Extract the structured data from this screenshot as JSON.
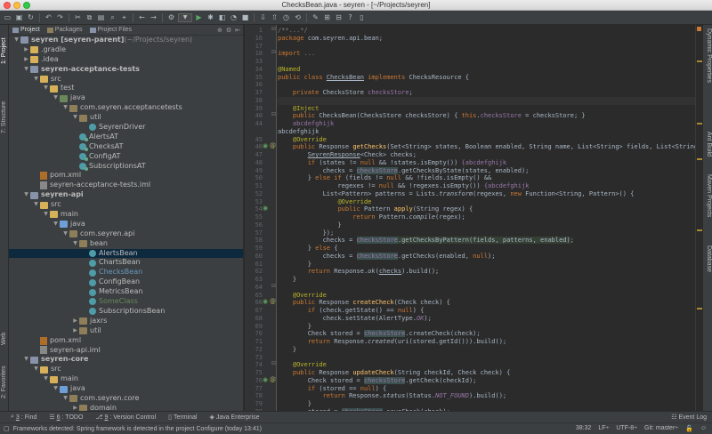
{
  "window": {
    "title": "ChecksBean.java - seyren - [~/Projects/seyren]"
  },
  "toolbar": {
    "buttons": [
      "open-icon",
      "save-icon",
      "sync-icon",
      "undo-icon",
      "redo-icon",
      "cut-icon",
      "copy-icon",
      "paste-icon",
      "find-icon",
      "replace-icon",
      "back-icon",
      "forward-icon",
      "make-icon",
      "run-config-dropdown",
      "run-icon",
      "debug-icon",
      "coverage-icon",
      "profile-icon",
      "stop-icon",
      "vcs-update-icon",
      "vcs-commit-icon",
      "history-icon",
      "revert-icon",
      "settings-icon",
      "structure-icon",
      "sdk-icon",
      "help-icon",
      "terminal-icon"
    ]
  },
  "left_strip": {
    "tabs": [
      "1: Project",
      "7: Structure",
      "Web",
      "2: Favorites"
    ]
  },
  "right_strip": {
    "tabs": [
      "Dynamic Properties",
      "Ant Build",
      "Maven Projects",
      "Database"
    ]
  },
  "project": {
    "tabs": [
      "Project",
      "Packages",
      "Project Files"
    ],
    "tree": [
      {
        "depth": 0,
        "arrow": "▼",
        "icon": "module",
        "label": "seyren [seyren-parent]",
        "suffix": " (~/Projects/seyren)",
        "bold": true
      },
      {
        "depth": 1,
        "arrow": "▶",
        "icon": "folder",
        "label": ".gradle"
      },
      {
        "depth": 1,
        "arrow": "▶",
        "icon": "folder",
        "label": ".idea"
      },
      {
        "depth": 1,
        "arrow": "▼",
        "icon": "module",
        "label": "seyren-acceptance-tests",
        "bold": true
      },
      {
        "depth": 2,
        "arrow": "▼",
        "icon": "folder",
        "label": "src"
      },
      {
        "depth": 3,
        "arrow": "▼",
        "icon": "folder",
        "label": "test"
      },
      {
        "depth": 4,
        "arrow": "▼",
        "icon": "folder green",
        "label": "java"
      },
      {
        "depth": 5,
        "arrow": "▼",
        "icon": "pkg",
        "label": "com.seyren.acceptancetests"
      },
      {
        "depth": 6,
        "arrow": "▼",
        "icon": "pkg",
        "label": "util"
      },
      {
        "depth": 7,
        "arrow": "",
        "icon": "cls",
        "label": "SeyrenDriver"
      },
      {
        "depth": 6,
        "arrow": "",
        "icon": "cls green",
        "label": "AlertsAT"
      },
      {
        "depth": 6,
        "arrow": "",
        "icon": "cls green",
        "label": "ChecksAT"
      },
      {
        "depth": 6,
        "arrow": "",
        "icon": "cls green",
        "label": "ConfigAT"
      },
      {
        "depth": 6,
        "arrow": "",
        "icon": "cls green",
        "label": "SubscriptionsAT"
      },
      {
        "depth": 2,
        "arrow": "",
        "icon": "xml",
        "label": "pom.xml"
      },
      {
        "depth": 2,
        "arrow": "",
        "icon": "iml",
        "label": "seyren-acceptance-tests.iml"
      },
      {
        "depth": 1,
        "arrow": "▼",
        "icon": "module",
        "label": "seyren-api",
        "bold": true
      },
      {
        "depth": 2,
        "arrow": "▼",
        "icon": "folder",
        "label": "src"
      },
      {
        "depth": 3,
        "arrow": "▼",
        "icon": "folder",
        "label": "main"
      },
      {
        "depth": 4,
        "arrow": "▼",
        "icon": "folder blue",
        "label": "java"
      },
      {
        "depth": 5,
        "arrow": "▼",
        "icon": "pkg",
        "label": "com.seyren.api"
      },
      {
        "depth": 6,
        "arrow": "▼",
        "icon": "pkg",
        "label": "bean"
      },
      {
        "depth": 7,
        "arrow": "",
        "icon": "cls",
        "label": "AlertsBean",
        "selected": true
      },
      {
        "depth": 7,
        "arrow": "",
        "icon": "cls",
        "label": "ChartsBean"
      },
      {
        "depth": 7,
        "arrow": "",
        "icon": "cls",
        "label": "ChecksBean",
        "color": "blue"
      },
      {
        "depth": 7,
        "arrow": "",
        "icon": "cls",
        "label": "ConfigBean"
      },
      {
        "depth": 7,
        "arrow": "",
        "icon": "cls",
        "label": "MetricsBean"
      },
      {
        "depth": 7,
        "arrow": "",
        "icon": "cls",
        "label": "SomeClass",
        "color": "green"
      },
      {
        "depth": 7,
        "arrow": "",
        "icon": "cls",
        "label": "SubscriptionsBean"
      },
      {
        "depth": 6,
        "arrow": "▶",
        "icon": "pkg",
        "label": "jaxrs"
      },
      {
        "depth": 6,
        "arrow": "▶",
        "icon": "pkg",
        "label": "util"
      },
      {
        "depth": 2,
        "arrow": "",
        "icon": "xml",
        "label": "pom.xml"
      },
      {
        "depth": 2,
        "arrow": "",
        "icon": "iml",
        "label": "seyren-api.iml"
      },
      {
        "depth": 1,
        "arrow": "▼",
        "icon": "module",
        "label": "seyren-core",
        "bold": true
      },
      {
        "depth": 2,
        "arrow": "▼",
        "icon": "folder",
        "label": "src"
      },
      {
        "depth": 3,
        "arrow": "▼",
        "icon": "folder",
        "label": "main"
      },
      {
        "depth": 4,
        "arrow": "▼",
        "icon": "folder blue",
        "label": "java"
      },
      {
        "depth": 5,
        "arrow": "▼",
        "icon": "pkg",
        "label": "com.seyren.core"
      },
      {
        "depth": 6,
        "arrow": "▶",
        "icon": "pkg",
        "label": "domain"
      },
      {
        "depth": 6,
        "arrow": "▶",
        "icon": "pkg",
        "label": "exception"
      }
    ]
  },
  "editor": {
    "current_line": 38,
    "lines": [
      {
        "n": "1",
        "html": "<span class=\"cm\">/**...*/</span>"
      },
      {
        "n": "16",
        "html": "<span class=\"kw\">package</span> com.seyren.api.bean;"
      },
      {
        "n": "17",
        "html": ""
      },
      {
        "n": "18",
        "html": "<span class=\"kw\">import</span> <span class=\"cm\">...</span>"
      },
      {
        "n": "33",
        "html": ""
      },
      {
        "n": "34",
        "html": "<span class=\"an\">@Named</span>"
      },
      {
        "n": "35",
        "html": "<span class=\"kw\">public class</span> <span class=\"ul\">ChecksBean</span> <span class=\"kw\">implements</span> ChecksResource {"
      },
      {
        "n": "36",
        "html": ""
      },
      {
        "n": "37",
        "html": "    <span class=\"kw\">private</span> ChecksStore <span class=\"fd\">checksStore</span>;"
      },
      {
        "n": "38",
        "html": ""
      },
      {
        "n": "39",
        "html": "    <span class=\"an\">@Inject</span>"
      },
      {
        "n": "40",
        "html": "    <span class=\"kw\">public</span> ChecksBean(ChecksStore checksStore) { <span class=\"kw\">this</span>.<span class=\"fd\">checksStore</span> = checksStore; }"
      },
      {
        "n": "44",
        "html": "    <span class=\"fd\">abcdefghijk</span>"
      },
      {
        "n": "",
        "html": "abcdefghijk"
      },
      {
        "n": "45",
        "html": "    <span class=\"an\">@Override</span>"
      },
      {
        "n": "46",
        "html": "    <span class=\"kw\">public</span> Response <span class=\"fn\">getChecks</span>(Set&lt;String&gt; states, Boolean enabled, String name, List&lt;String&gt; fields, List&lt;String&gt; regexes) {"
      },
      {
        "n": "47",
        "html": "        <span class=\"ul\">SeyrenResponse</span>&lt;Check&gt; checks;"
      },
      {
        "n": "48",
        "html": "        <span class=\"kw\">if</span> (states != <span class=\"kw\">null</span> &amp;&amp; !states.isEmpty()) <span class=\"fd\">{abcdefghijk</span>"
      },
      {
        "n": "49",
        "html": "            checks = <span class=\"fd hl2\">checksStore</span>.getChecksByState(states, enabled);"
      },
      {
        "n": "50",
        "html": "        } <span class=\"kw\">else if</span> (fields != <span class=\"kw\">null</span> &amp;&amp; !fields.isEmpty() &amp;&amp;"
      },
      {
        "n": "51",
        "html": "                regexes != <span class=\"kw\">null</span> &amp;&amp; !regexes.isEmpty()) <span class=\"fd\">{abcdefghijk</span>"
      },
      {
        "n": "52",
        "html": "            List&lt;Pattern&gt; patterns = Lists.<span class=\"it\">transform</span>(regexes, <span class=\"kw\">new</span> Function&lt;String, Pattern&gt;() {"
      },
      {
        "n": "53",
        "html": "                <span class=\"an\">@Override</span>"
      },
      {
        "n": "54",
        "html": "                <span class=\"kw\">public</span> Pattern <span class=\"fn\">apply</span>(String regex) {"
      },
      {
        "n": "55",
        "html": "                    <span class=\"kw\">return</span> Pattern.<span class=\"it\">compile</span>(regex);"
      },
      {
        "n": "56",
        "html": "                }"
      },
      {
        "n": "57",
        "html": "            });"
      },
      {
        "n": "58",
        "html": "            checks = <span class=\"fd hl2\">checksStore</span><span class=\"hl\">.getChecksByPattern(fields, patterns, enabled)</span>;"
      },
      {
        "n": "59",
        "html": "        } <span class=\"kw\">else</span> {"
      },
      {
        "n": "60",
        "html": "            checks = <span class=\"fd hl2\">checksStore</span>.getChecks(enabled, <span class=\"kw\">null</span>);"
      },
      {
        "n": "61",
        "html": "        }"
      },
      {
        "n": "62",
        "html": "        <span class=\"kw\">return</span> Response.<span class=\"it\">ok</span>(<span class=\"ul\">checks</span>).build();"
      },
      {
        "n": "63",
        "html": "    }"
      },
      {
        "n": "64",
        "html": ""
      },
      {
        "n": "65",
        "html": "    <span class=\"an\">@Override</span>"
      },
      {
        "n": "66",
        "html": "    <span class=\"kw\">public</span> Response <span class=\"fn\">createCheck</span>(Check check) {"
      },
      {
        "n": "67",
        "html": "        <span class=\"kw\">if</span> (check.getState() == <span class=\"kw\">null</span>) {"
      },
      {
        "n": "68",
        "html": "            check.setState(AlertType.<span class=\"fd it\">OK</span>);"
      },
      {
        "n": "69",
        "html": "        }"
      },
      {
        "n": "70",
        "html": "        Check stored = <span class=\"fd hl2\">checksStore</span>.createCheck(check);"
      },
      {
        "n": "71",
        "html": "        <span class=\"kw\">return</span> Response.<span class=\"it\">created</span>(uri(stored.getId())).build();"
      },
      {
        "n": "72",
        "html": "    }"
      },
      {
        "n": "73",
        "html": ""
      },
      {
        "n": "74",
        "html": "    <span class=\"an\">@Override</span>"
      },
      {
        "n": "75",
        "html": "    <span class=\"kw\">public</span> Response <span class=\"fn\">updateCheck</span>(String checkId, Check check) {"
      },
      {
        "n": "76",
        "html": "        Check stored = <span class=\"fd hl2\">checksStore</span>.getCheck(checkId);"
      },
      {
        "n": "77",
        "html": "        <span class=\"kw\">if</span> (stored == <span class=\"kw\">null</span>) {"
      },
      {
        "n": "78",
        "html": "            <span class=\"kw\">return</span> Response.<span class=\"it\">status</span>(Status.<span class=\"fd it\">NOT_FOUND</span>).build();"
      },
      {
        "n": "79",
        "html": "        }"
      },
      {
        "n": "80",
        "html": "        stored = <span class=\"fd hl2\">checksStore</span>.saveCheck(check);"
      },
      {
        "n": "81",
        "html": "        <span class=\"kw\">return</span> Response.<span class=\"it\">ok</span>(stored).build();"
      },
      {
        "n": "82",
        "html": "    }"
      }
    ]
  },
  "bottom_tabs": [
    {
      "num": "3",
      "label": ": Find"
    },
    {
      "num": "6",
      "label": ": TODO"
    },
    {
      "num": "9",
      "label": ": Version Control"
    },
    {
      "num": "",
      "label": "Terminal"
    },
    {
      "num": "",
      "label": "Java Enterprise"
    }
  ],
  "event_log": "Event Log",
  "status": {
    "message": "Frameworks detected: Spring framework is detected in the project Configure (today 13:41)",
    "position": "38:32",
    "separator": "LF÷",
    "encoding": "UTF-8÷",
    "vcs": "Git: master÷"
  },
  "colors": {
    "background": "#2b2b2b",
    "panel": "#3c3f41",
    "selection": "#0d293e",
    "keyword": "#cc7832",
    "annotation": "#bbb529",
    "method": "#ffc66d",
    "field": "#9876aa"
  }
}
